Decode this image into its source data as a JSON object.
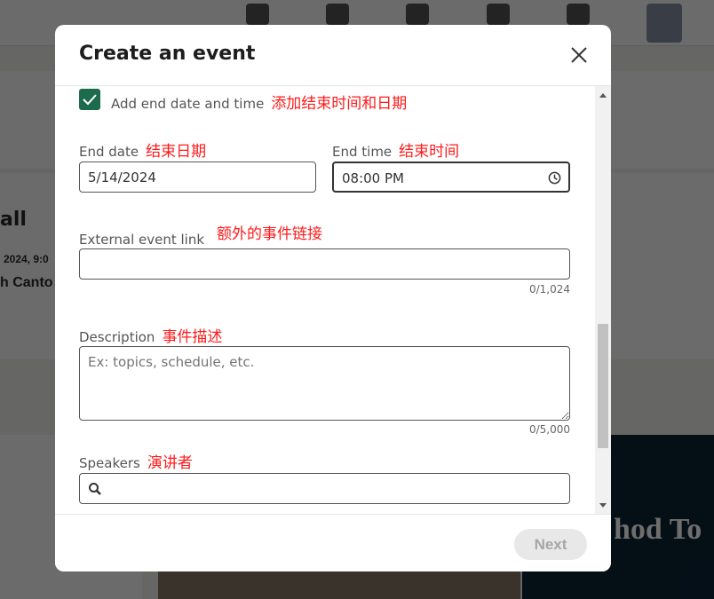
{
  "background": {
    "text_title": "all",
    "text_date": "2024, 9:0",
    "text_place": "h Canto",
    "image_text": "hod To"
  },
  "modal": {
    "title": "Create an event",
    "end_datetime_checkbox": {
      "label": "Add end date and time",
      "annotation": "添加结束时间和日期",
      "checked": true
    },
    "end_date": {
      "label": "End date",
      "annotation": "结束日期",
      "value": "5/14/2024"
    },
    "end_time": {
      "label": "End time",
      "annotation": "结束时间",
      "value": "08:00 PM"
    },
    "external_link": {
      "label": "External event link",
      "annotation": "额外的事件链接",
      "value": "",
      "counter": "0/1,024"
    },
    "description": {
      "label": "Description",
      "annotation": "事件描述",
      "placeholder": "Ex: topics, schedule, etc.",
      "counter": "0/5,000"
    },
    "speakers": {
      "label": "Speakers",
      "annotation": "演讲者",
      "value": ""
    },
    "next_label": "Next"
  },
  "colors": {
    "checkbox": "#1b6b4c",
    "annotation": "#ff1a1a"
  }
}
